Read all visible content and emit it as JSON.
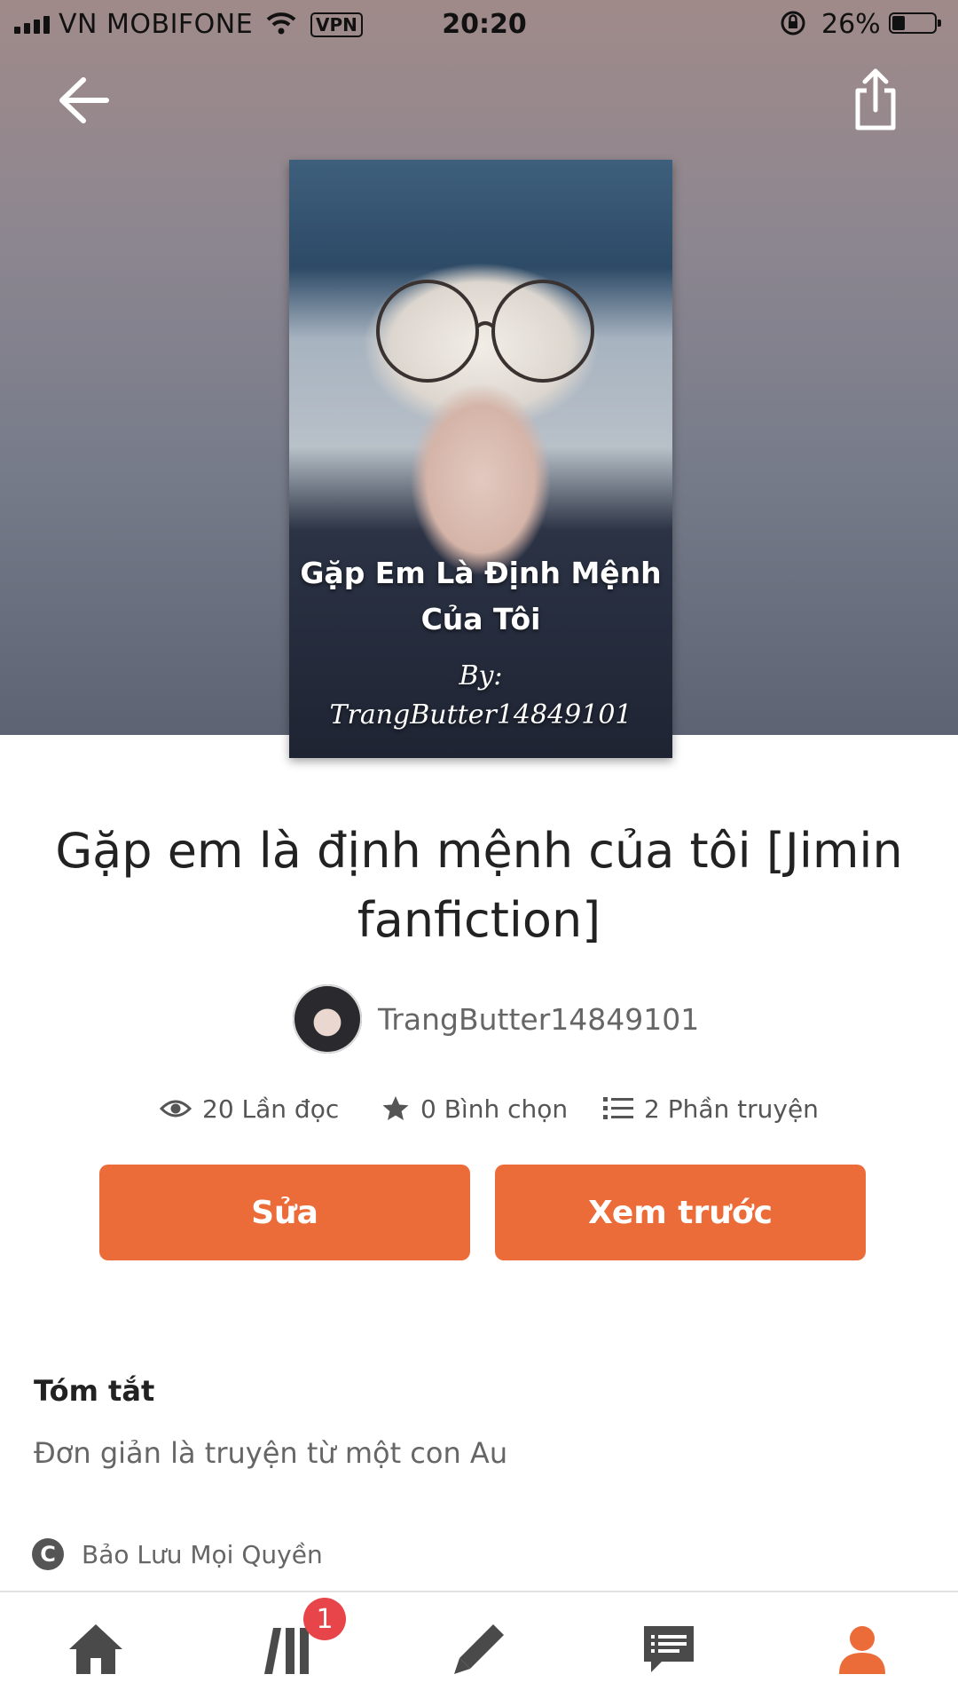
{
  "status_bar": {
    "carrier": "VN MOBIFONE",
    "vpn": "VPN",
    "time": "20:20",
    "battery_percent": "26%",
    "battery_level": 0.26
  },
  "header": {
    "back_icon": "arrow-left-icon",
    "share_icon": "share-icon"
  },
  "cover": {
    "title_line1": "Gặp Em Là Định Mệnh",
    "title_line2": "Của Tôi",
    "by_label": "By:",
    "by_author": "TrangButter14849101"
  },
  "story": {
    "title": "Gặp em là định mệnh của tôi [Jimin fanfiction]",
    "author": "TrangButter14849101",
    "stats": {
      "reads": "20 Lần đọc",
      "votes": "0 Bình chọn",
      "parts": "2 Phần truyện"
    }
  },
  "actions": {
    "edit_label": "Sửa",
    "preview_label": "Xem trước"
  },
  "summary": {
    "heading": "Tóm tắt",
    "text": "Đơn giản là truyện từ một con Au"
  },
  "copyright": {
    "symbol": "C",
    "text": "Bảo Lưu Mọi Quyền"
  },
  "bottom_nav": {
    "items": [
      {
        "icon": "home-icon",
        "active": false
      },
      {
        "icon": "library-icon",
        "active": false,
        "badge": "1"
      },
      {
        "icon": "pencil-icon",
        "active": false
      },
      {
        "icon": "messages-icon",
        "active": false
      },
      {
        "icon": "profile-icon",
        "active": true
      }
    ]
  },
  "colors": {
    "accent": "#ec6c39",
    "badge": "#e8454a",
    "nav_inactive": "#4a4a4a"
  }
}
